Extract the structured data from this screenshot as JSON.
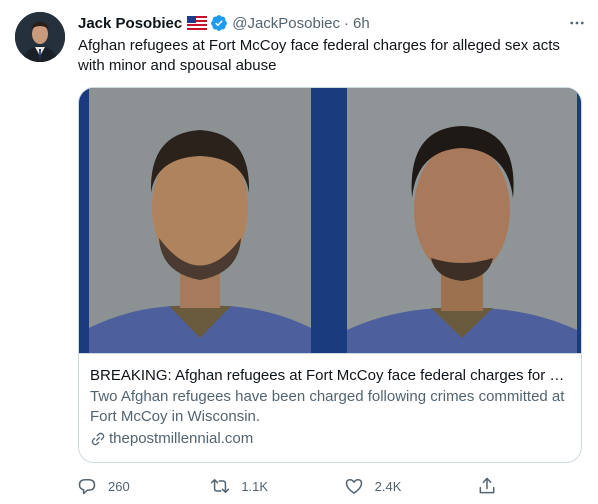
{
  "author": {
    "name": "Jack Posobiec",
    "handle": "@JackPosobiec",
    "separator": "·",
    "time": "6h",
    "flag_icon": "us-flag-icon",
    "verified_icon": "verified-badge-icon"
  },
  "tweet": {
    "text": "Afghan refugees at Fort McCoy face federal charges for alleged sex acts with minor and spousal abuse"
  },
  "card": {
    "title": "BREAKING: Afghan refugees at Fort McCoy face federal charges for alleged sex acts with minor and spousal abuse",
    "description": "Two Afghan refugees have been charged following crimes committed at Fort McCoy in Wisconsin.",
    "domain": "thepostmillennial.com"
  },
  "actions": {
    "replies": "260",
    "retweets": "1.1K",
    "likes": "2.4K"
  },
  "colors": {
    "text_primary": "#0f1419",
    "text_secondary": "#536471",
    "border": "#cfd9de",
    "verified_blue": "#1d9bf0"
  }
}
